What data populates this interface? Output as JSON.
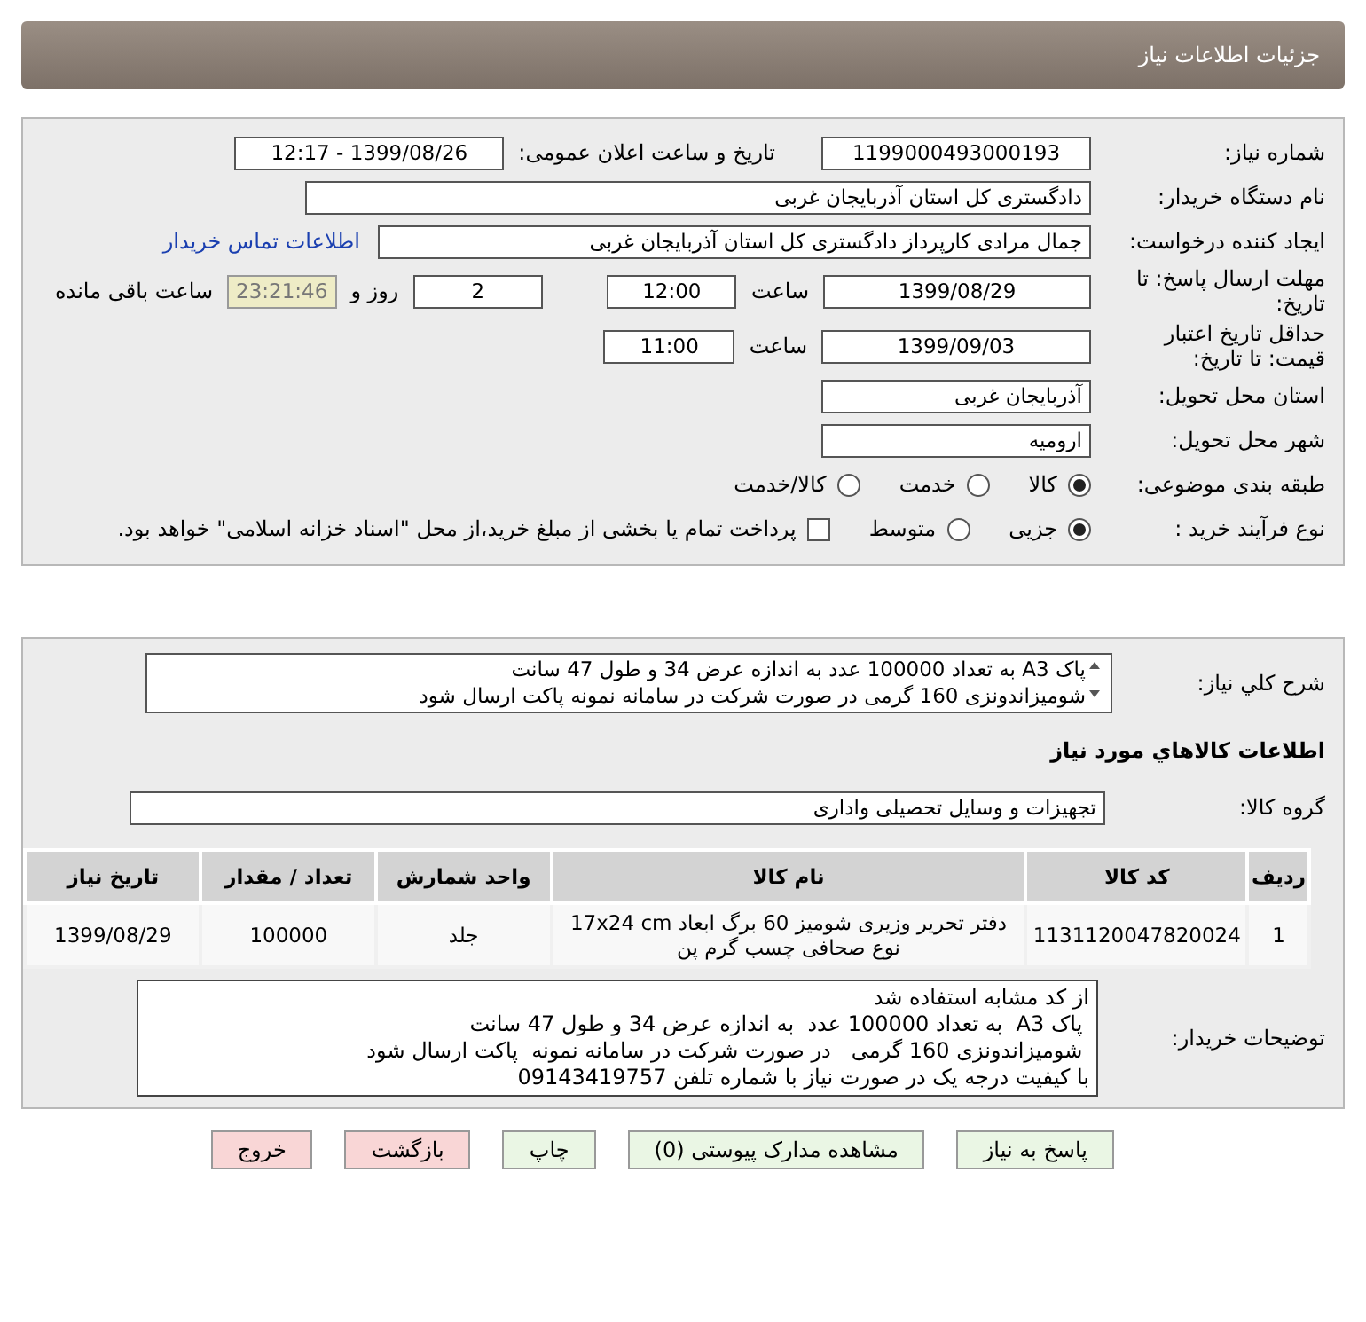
{
  "header": {
    "title": "جزئیات اطلاعات نیاز"
  },
  "need_number": {
    "label": "شماره نیاز:",
    "value": "1199000493000193"
  },
  "announce": {
    "label": "تاریخ و ساعت اعلان عمومی:",
    "value": "1399/08/26 - 12:17"
  },
  "buyer_org": {
    "label": "نام دستگاه خریدار:",
    "value": "دادگستری کل استان آذربایجان غربی"
  },
  "requester": {
    "label": "ایجاد کننده درخواست:",
    "value": "جمال مرادی کارپرداز دادگستری کل استان آذربایجان غربی",
    "link": "اطلاعات تماس خریدار"
  },
  "deadline": {
    "label": "مهلت ارسال پاسخ: تا تاریخ:",
    "date": "1399/08/29",
    "time_label": "ساعت",
    "time": "12:00",
    "days": "2",
    "days_label": "روز و",
    "countdown": "23:21:46",
    "remaining_label": "ساعت باقی مانده"
  },
  "validity": {
    "label": "حداقل تاریخ اعتبار قیمت: تا تاریخ:",
    "date": "1399/09/03",
    "time_label": "ساعت",
    "time": "11:00"
  },
  "province": {
    "label": "استان محل تحویل:",
    "value": "آذربایجان غربی"
  },
  "city": {
    "label": "شهر محل تحویل:",
    "value": "ارومیه"
  },
  "category": {
    "label": "طبقه بندی موضوعی:",
    "options": [
      {
        "label": "کالا",
        "selected": true
      },
      {
        "label": "خدمت",
        "selected": false
      },
      {
        "label": "کالا/خدمت",
        "selected": false
      }
    ]
  },
  "process": {
    "label": "نوع فرآیند خرید :",
    "options": [
      {
        "label": "جزیی",
        "selected": true
      },
      {
        "label": "متوسط",
        "selected": false
      }
    ],
    "payment": {
      "label": "پرداخت تمام یا بخشی از مبلغ خرید،از محل \"اسناد خزانه اسلامی\" خواهد بود.",
      "checked": false
    }
  },
  "description": {
    "label": "شرح كلي نياز:",
    "lines": [
      "پاک A3  به تعداد 100000 عدد  به اندازه عرض 34 و طول 47 سانت",
      "شومیزاندونزی 160 گرمی   در صورت شرکت در سامانه نمونه  پاکت ارسال شود"
    ]
  },
  "goods_title": "اطلاعات كالاهاي مورد نياز",
  "goods_group": {
    "label": "گروه کالا:",
    "value": "تجهیزات و وسایل تحصیلی واداری"
  },
  "table": {
    "columns": [
      "ردیف",
      "کد کالا",
      "نام کالا",
      "واحد شمارش",
      "تعداد / مقدار",
      "تاریخ نیاز"
    ],
    "rows": [
      [
        "1",
        "1131120047820024",
        "دفتر تحریر وزیری شومیز 60 برگ ابعاد 17x24 cm نوع صحافی چسب گرم پن",
        "جلد",
        "100000",
        "1399/08/29"
      ]
    ]
  },
  "buyer_notes": {
    "label": "توضیحات خریدار:",
    "lines": [
      "از کد مشابه استفاده شد",
      " پاک A3  به تعداد 100000 عدد  به اندازه عرض 34 و طول 47 سانت",
      " شومیزاندونزی 160 گرمی   در صورت شرکت در سامانه نمونه  پاکت ارسال شود",
      "با کیفیت درجه یک در صورت نیاز با شماره تلفن 09143419757"
    ]
  },
  "buttons": [
    {
      "label": "پاسخ به نیاز",
      "kind": "normal"
    },
    {
      "label": "مشاهده مدارک پیوستی (0)",
      "kind": "normal"
    },
    {
      "label": "چاپ",
      "kind": "normal"
    },
    {
      "label": "بازگشت",
      "kind": "danger"
    },
    {
      "label": "خروج",
      "kind": "danger"
    }
  ]
}
